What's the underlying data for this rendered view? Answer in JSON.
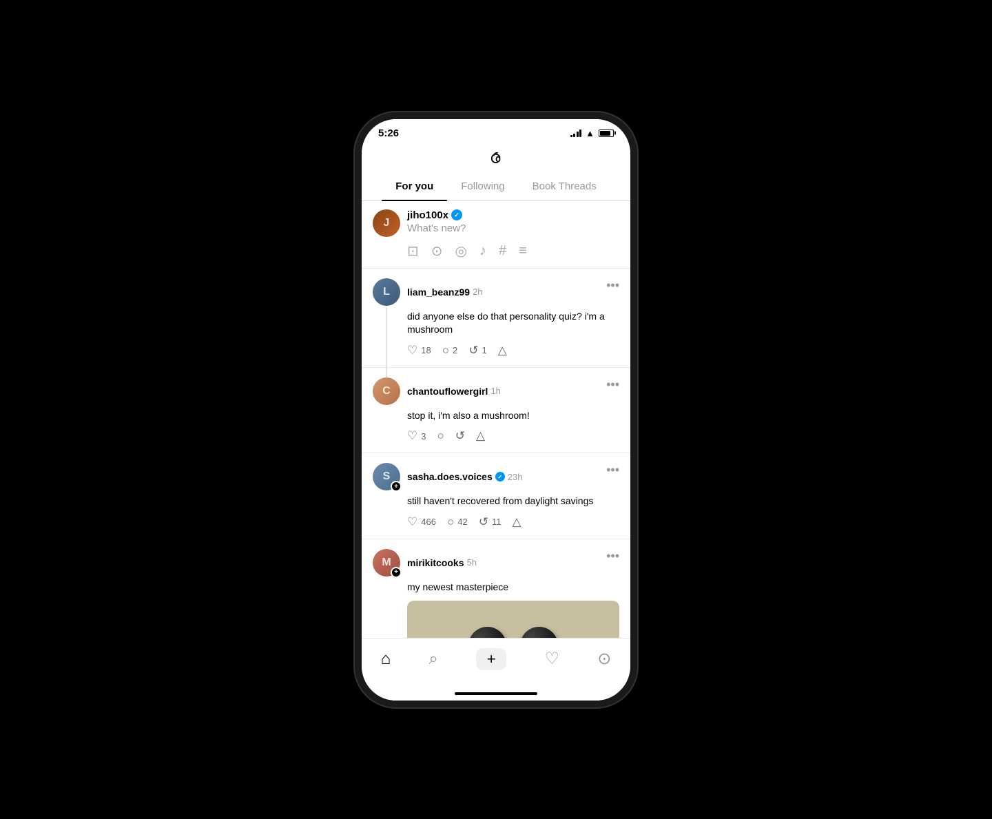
{
  "status_bar": {
    "time": "5:26"
  },
  "tabs": [
    {
      "id": "for-you",
      "label": "For you",
      "active": true
    },
    {
      "id": "following",
      "label": "Following",
      "active": false
    },
    {
      "id": "book-threads",
      "label": "Book Threads",
      "active": false
    }
  ],
  "compose": {
    "username": "jiho100x",
    "verified": true,
    "placeholder": "What's new?",
    "icons": [
      "gallery",
      "camera",
      "gif",
      "microphone",
      "hashtag",
      "more"
    ]
  },
  "posts": [
    {
      "id": "post1",
      "username": "liam_beanz99",
      "verified": false,
      "time": "2h",
      "content": "did anyone else do that personality quiz? i'm a mushroom",
      "likes": 18,
      "comments": 2,
      "reposts": 1,
      "has_thread": true
    },
    {
      "id": "reply1",
      "username": "chantouflowergirl",
      "verified": false,
      "time": "1h",
      "content": "stop it, i'm also a mushroom!",
      "likes": 3,
      "comments": 0,
      "reposts": 0,
      "is_reply": true
    },
    {
      "id": "post2",
      "username": "sasha.does.voices",
      "verified": true,
      "time": "23h",
      "content": "still haven't recovered from daylight savings",
      "likes": 466,
      "comments": 42,
      "reposts": 11,
      "has_plus": true
    },
    {
      "id": "post3",
      "username": "mirikitcooks",
      "verified": false,
      "time": "5h",
      "content": "my newest masterpiece",
      "likes": 0,
      "comments": 0,
      "reposts": 0,
      "has_image": true,
      "has_plus": true
    }
  ],
  "bottom_nav": {
    "items": [
      {
        "id": "home",
        "icon": "home",
        "active": true
      },
      {
        "id": "search",
        "icon": "search",
        "active": false
      },
      {
        "id": "create",
        "icon": "plus",
        "active": false
      },
      {
        "id": "likes",
        "icon": "heart",
        "active": false
      },
      {
        "id": "profile",
        "icon": "person",
        "active": false
      }
    ]
  }
}
